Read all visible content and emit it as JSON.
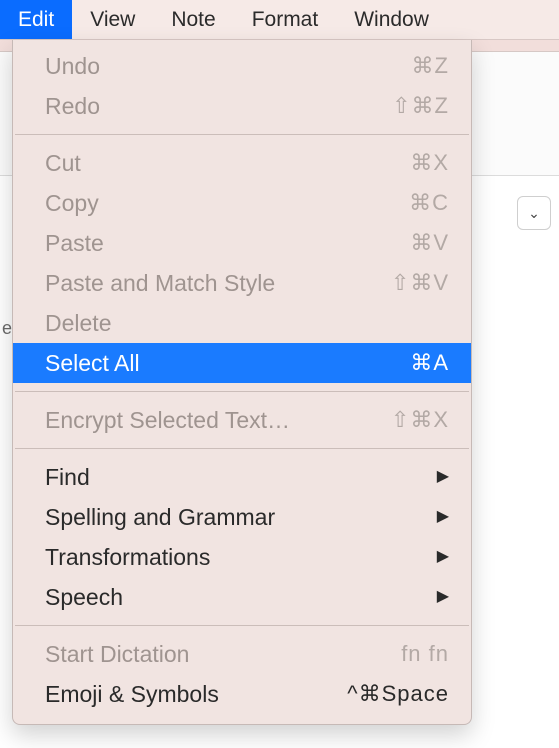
{
  "menubar": {
    "items": [
      {
        "label": "Edit",
        "active": true
      },
      {
        "label": "View",
        "active": false
      },
      {
        "label": "Note",
        "active": false
      },
      {
        "label": "Format",
        "active": false
      },
      {
        "label": "Window",
        "active": false
      }
    ]
  },
  "dropdown": {
    "groups": [
      [
        {
          "label": "Undo",
          "shortcut": "⌘Z",
          "disabled": true
        },
        {
          "label": "Redo",
          "shortcut": "⇧⌘Z",
          "disabled": true
        }
      ],
      [
        {
          "label": "Cut",
          "shortcut": "⌘X",
          "disabled": true
        },
        {
          "label": "Copy",
          "shortcut": "⌘C",
          "disabled": true
        },
        {
          "label": "Paste",
          "shortcut": "⌘V",
          "disabled": true
        },
        {
          "label": "Paste and Match Style",
          "shortcut": "⇧⌘V",
          "disabled": true
        },
        {
          "label": "Delete",
          "shortcut": "",
          "disabled": true
        },
        {
          "label": "Select All",
          "shortcut": "⌘A",
          "disabled": false,
          "highlight": true
        }
      ],
      [
        {
          "label": "Encrypt Selected Text…",
          "shortcut": "⇧⌘X",
          "disabled": true
        }
      ],
      [
        {
          "label": "Find",
          "submenu": true
        },
        {
          "label": "Spelling and Grammar",
          "submenu": true
        },
        {
          "label": "Transformations",
          "submenu": true
        },
        {
          "label": "Speech",
          "submenu": true
        }
      ],
      [
        {
          "label": "Start Dictation",
          "shortcut": "fn fn",
          "disabled": true
        },
        {
          "label": "Emoji & Symbols",
          "shortcut": "^⌘Space",
          "disabled": false
        }
      ]
    ]
  },
  "background": {
    "chevron_glyph": "⌄",
    "left_edge_fragment": "e"
  }
}
